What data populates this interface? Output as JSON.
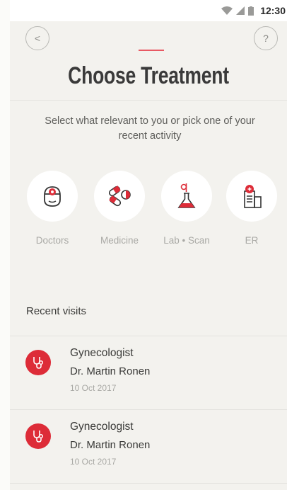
{
  "status_bar": {
    "time": "12:30",
    "icons": [
      "wifi-icon",
      "signal-icon",
      "battery-icon"
    ]
  },
  "header": {
    "back_icon": "chevron-left-icon",
    "back_glyph": "<",
    "help_icon": "question-icon",
    "help_glyph": "?",
    "title": "Choose Treatment"
  },
  "subtitle": "Select what relevant to you or pick one of your recent activity",
  "categories": [
    {
      "label": "Doctors",
      "icon": "doctor-icon"
    },
    {
      "label": "Medicine",
      "icon": "pills-icon"
    },
    {
      "label": "Lab • Scan",
      "icon": "flask-icon"
    },
    {
      "label": "ER",
      "icon": "hospital-icon"
    }
  ],
  "recent": {
    "title": "Recent visits",
    "items": [
      {
        "specialty": "Gynecologist",
        "doctor": "Dr. Martin Ronen",
        "date": "10 Oct 2017",
        "icon": "stethoscope-icon"
      },
      {
        "specialty": "Gynecologist",
        "doctor": "Dr. Martin Ronen",
        "date": "10 Oct 2017",
        "icon": "stethoscope-icon"
      }
    ]
  },
  "colors": {
    "accent": "#dd2c38",
    "accent_line": "#e85963",
    "background": "#f3f2ee",
    "status_bar": "#ffffff"
  }
}
